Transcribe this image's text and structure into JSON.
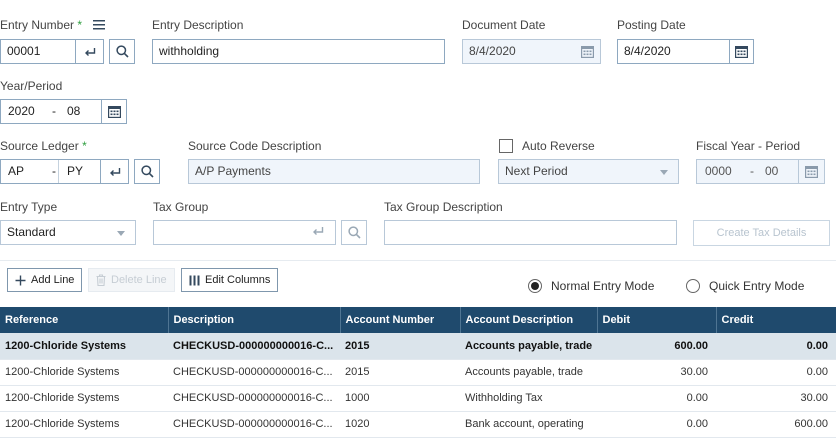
{
  "header": {
    "entry_number": {
      "label": "Entry Number",
      "required_mark": "*",
      "value": "00001"
    },
    "entry_description": {
      "label": "Entry Description",
      "value": "withholding"
    },
    "document_date": {
      "label": "Document Date",
      "value": "8/4/2020"
    },
    "posting_date": {
      "label": "Posting Date",
      "value": "8/4/2020"
    },
    "year_period": {
      "label": "Year/Period",
      "year": "2020",
      "separator": "-",
      "period": "08"
    },
    "source_ledger": {
      "label": "Source Ledger",
      "required_mark": "*",
      "ledger": "AP",
      "separator": "-",
      "code": "PY"
    },
    "source_code_description": {
      "label": "Source Code Description",
      "value": "A/P Payments"
    },
    "auto_reverse": {
      "label": "Auto Reverse",
      "checked": false,
      "option": "Next Period"
    },
    "fiscal_year_period": {
      "label": "Fiscal Year - Period",
      "year": "0000",
      "separator": "-",
      "period": "00"
    },
    "entry_type": {
      "label": "Entry Type",
      "value": "Standard"
    },
    "tax_group": {
      "label": "Tax Group",
      "value": ""
    },
    "tax_group_description": {
      "label": "Tax Group Description",
      "value": ""
    },
    "create_tax_details_label": "Create Tax Details"
  },
  "toolbar": {
    "add_line": "Add Line",
    "delete_line": "Delete Line",
    "edit_columns": "Edit Columns"
  },
  "modes": {
    "normal": {
      "label": "Normal Entry Mode",
      "selected": true
    },
    "quick": {
      "label": "Quick Entry Mode",
      "selected": false
    }
  },
  "grid": {
    "columns": [
      "Reference",
      "Description",
      "Account Number",
      "Account Description",
      "Debit",
      "Credit"
    ],
    "rows": [
      {
        "reference": "1200-Chloride Systems",
        "description": "CHECKUSD-000000000016-C...",
        "account_number": "2015",
        "account_description": "Accounts payable, trade",
        "debit": "600.00",
        "credit": "0.00"
      },
      {
        "reference": "1200-Chloride Systems",
        "description": "CHECKUSD-000000000016-C...",
        "account_number": "2015",
        "account_description": "Accounts payable, trade",
        "debit": "30.00",
        "credit": "0.00"
      },
      {
        "reference": "1200-Chloride Systems",
        "description": "CHECKUSD-000000000016-C...",
        "account_number": "1000",
        "account_description": "Withholding Tax",
        "debit": "0.00",
        "credit": "30.00"
      },
      {
        "reference": "1200-Chloride Systems",
        "description": "CHECKUSD-000000000016-C...",
        "account_number": "1020",
        "account_description": "Bank account, operating",
        "debit": "0.00",
        "credit": "600.00"
      }
    ]
  },
  "colors": {
    "required": "#2e9e3f",
    "header_bg": "#1f4a6d",
    "selected_row": "#dbe4eb",
    "field_border": "#8ea8c0"
  },
  "icons": [
    "menu-icon",
    "enter-icon",
    "search-icon",
    "calendar-icon",
    "chevron-down-icon",
    "plus-icon",
    "trash-icon",
    "columns-icon"
  ]
}
